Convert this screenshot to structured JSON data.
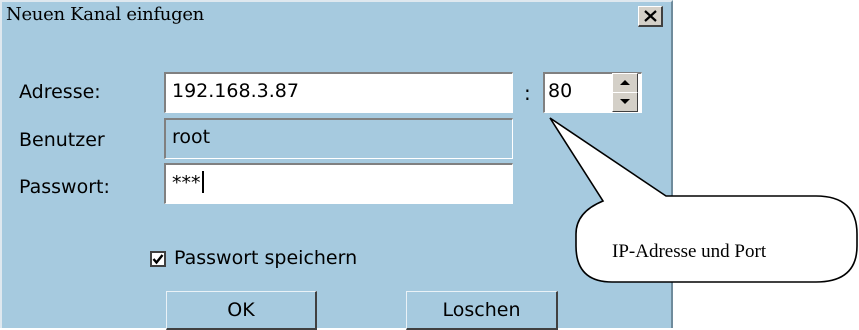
{
  "window": {
    "title": "Neuen Kanal einfugen",
    "close_icon": "close-icon"
  },
  "form": {
    "address_label": "Adresse:",
    "address_value": "192.168.3.87",
    "port_separator": ":",
    "port_value": "80",
    "user_label": "Benutzer",
    "user_value": "root",
    "password_label": "Passwort:",
    "password_value": "***",
    "save_password_label": "Passwort speichern",
    "save_password_checked": true
  },
  "buttons": {
    "ok_label": "OK",
    "delete_label": "Loschen"
  },
  "callout": {
    "text": "IP-Adresse und Port"
  },
  "colors": {
    "dialog_bg": "#a6cadf",
    "field_bg": "#ffffff"
  }
}
